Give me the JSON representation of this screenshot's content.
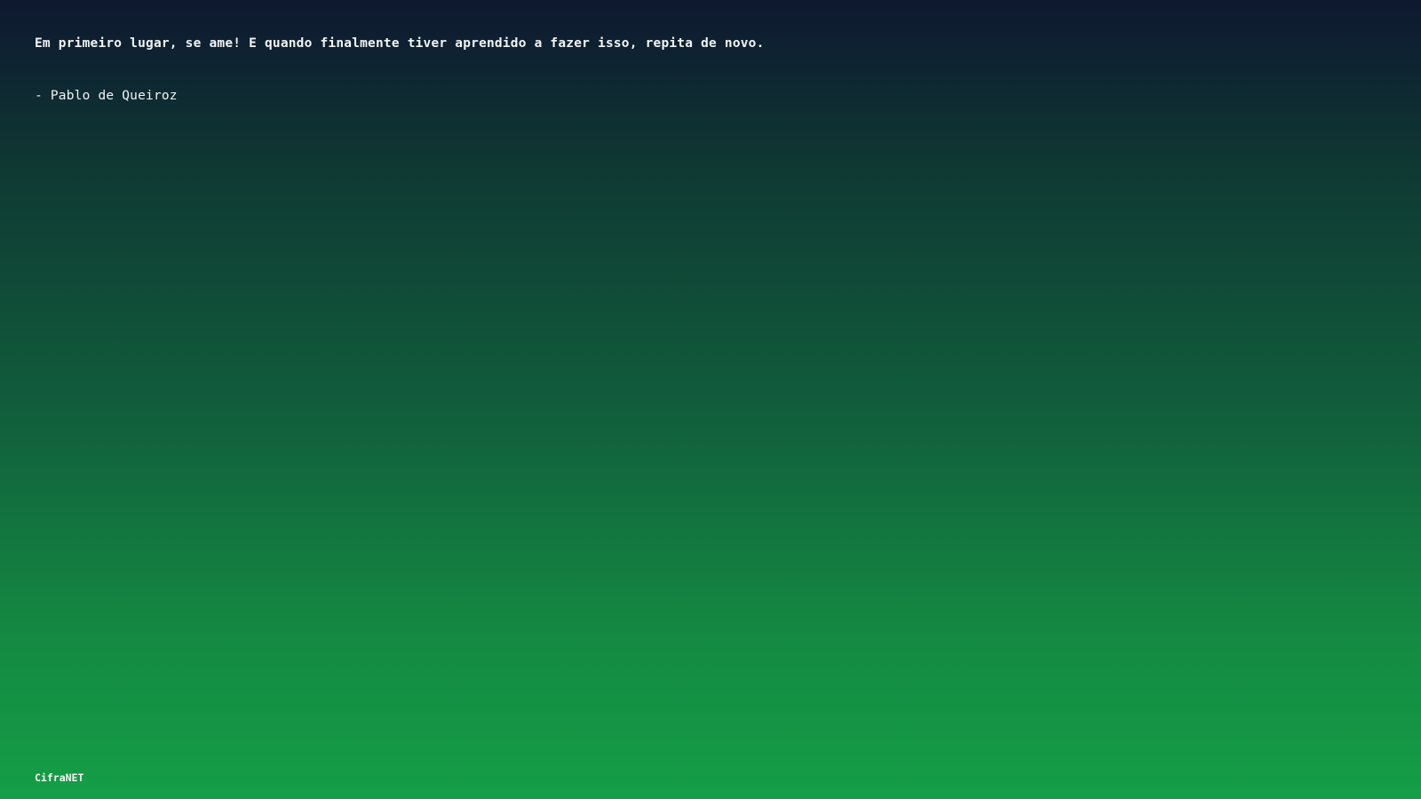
{
  "quote": {
    "text": "Em primeiro lugar, se ame! E quando finalmente tiver aprendido a fazer isso, repita de novo.",
    "author": "- Pablo de Queiroz"
  },
  "footer": {
    "brand": "CifraNET"
  },
  "colors": {
    "background_top": "#0e1830",
    "background_bottom": "#159e47",
    "text": "#f2f4f3"
  }
}
